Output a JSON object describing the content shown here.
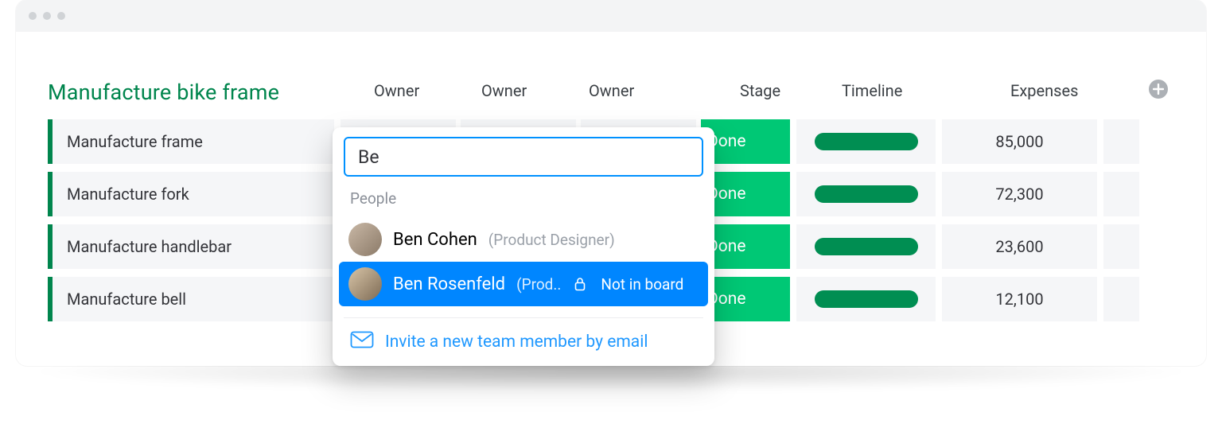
{
  "group_title": "Manufacture bike frame",
  "columns": {
    "owner1": "Owner",
    "owner2": "Owner",
    "owner3": "Owner",
    "stage": "Stage",
    "timeline": "Timeline",
    "expenses": "Expenses"
  },
  "rows": [
    {
      "task": "Manufacture frame",
      "stage": "Done",
      "expense": "85,000"
    },
    {
      "task": "Manufacture fork",
      "stage": "Done",
      "expense": "72,300"
    },
    {
      "task": "Manufacture handlebar",
      "stage": "Done",
      "expense": "23,600"
    },
    {
      "task": "Manufacture bell",
      "stage": "Done",
      "expense": "12,100"
    }
  ],
  "people_picker": {
    "query": "Be",
    "section_label": "People",
    "results": [
      {
        "name": "Ben Cohen",
        "role": "(Product Designer)",
        "selected": false,
        "not_in_board": false
      },
      {
        "name": "Ben Rosenfeld",
        "role": "(Prod..",
        "selected": true,
        "not_in_board": true,
        "badge": "Not in board"
      }
    ],
    "invite_label": "Invite a new team member by email"
  },
  "colors": {
    "accent_green": "#00854d",
    "status_green": "#00c875",
    "pill_green": "#008e52",
    "blue": "#0086ff"
  }
}
